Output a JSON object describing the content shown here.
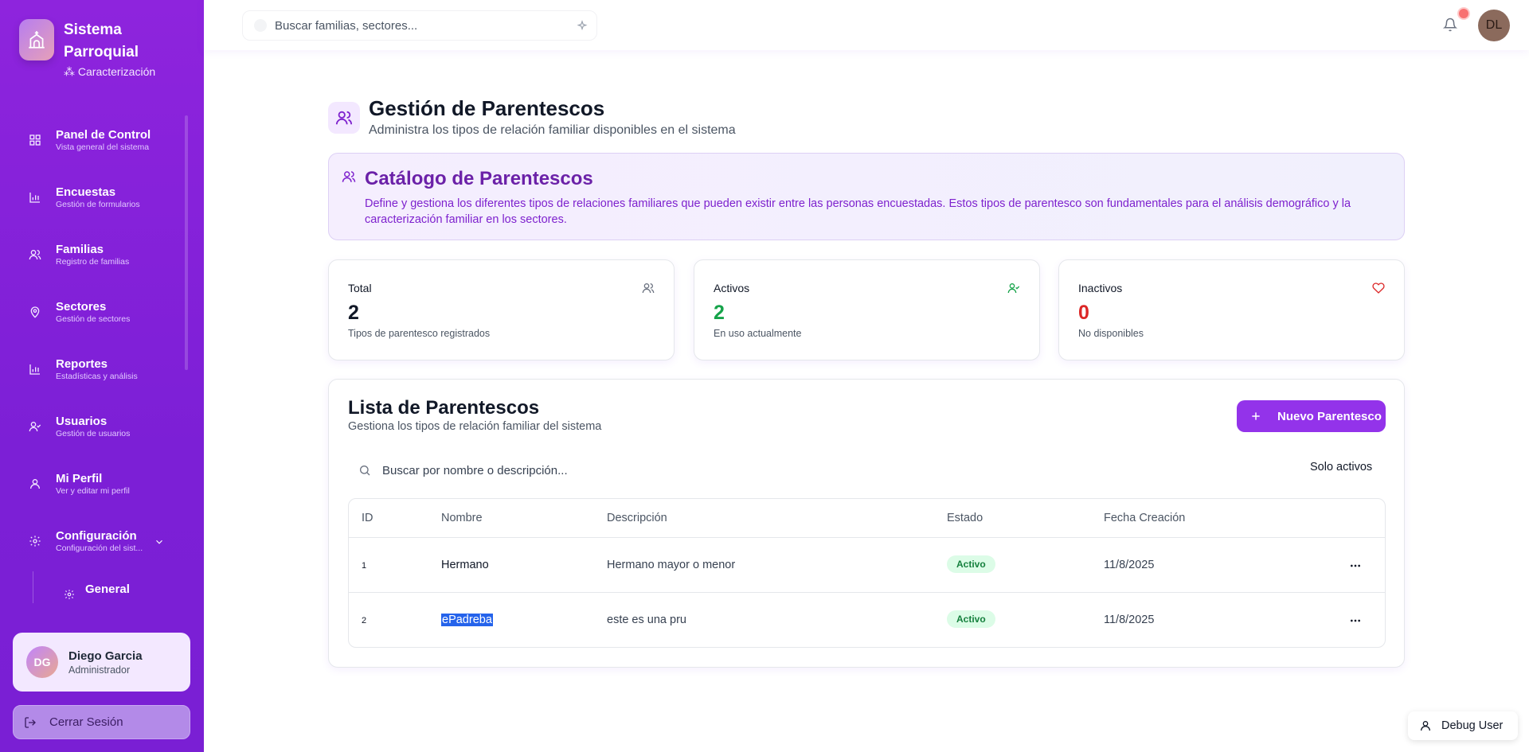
{
  "brand": {
    "title": "Sistema Parroquial",
    "subtitle": "Caracterización"
  },
  "sidebar": {
    "items": [
      {
        "label": "Panel de Control",
        "desc": "Vista general del sistema",
        "icon": "grid-icon"
      },
      {
        "label": "Encuestas",
        "desc": "Gestión de formularios",
        "icon": "bar-chart-icon"
      },
      {
        "label": "Familias",
        "desc": "Registro de familias",
        "icon": "users-icon"
      },
      {
        "label": "Sectores",
        "desc": "Gestión de sectores",
        "icon": "map-pin-icon"
      },
      {
        "label": "Reportes",
        "desc": "Estadísticas y análisis",
        "icon": "bar-chart-icon"
      },
      {
        "label": "Usuarios",
        "desc": "Gestión de usuarios",
        "icon": "user-check-icon"
      },
      {
        "label": "Mi Perfil",
        "desc": "Ver y editar mi perfil",
        "icon": "user-icon"
      },
      {
        "label": "Configuración",
        "desc": "Configuración del sist...",
        "icon": "gear-icon"
      }
    ],
    "sub_item": {
      "label": "General"
    },
    "user": {
      "initials": "DG",
      "name": "Diego Garcia",
      "role": "Administrador"
    },
    "logout_label": "Cerrar Sesión"
  },
  "topbar": {
    "search_placeholder": "Buscar familias, sectores...",
    "avatar_initials": "DL"
  },
  "page": {
    "title": "Gestión de Parentescos",
    "subtitle": "Administra los tipos de relación familiar disponibles en el sistema"
  },
  "catalog": {
    "title": "Catálogo de Parentescos",
    "description": "Define y gestiona los diferentes tipos de relaciones familiares que pueden existir entre las personas encuestadas. Estos tipos de parentesco son fundamentales para el análisis demográfico y la caracterización familiar en los sectores."
  },
  "stats": [
    {
      "label": "Total",
      "value": "2",
      "desc": "Tipos de parentesco registrados",
      "color": "#111827"
    },
    {
      "label": "Activos",
      "value": "2",
      "desc": "En uso actualmente",
      "color": "#16a34a"
    },
    {
      "label": "Inactivos",
      "value": "0",
      "desc": "No disponibles",
      "color": "#dc2626"
    }
  ],
  "list": {
    "title": "Lista de Parentescos",
    "subtitle": "Gestiona los tipos de relación familiar del sistema",
    "new_button": "Nuevo Parentesco",
    "search_placeholder": "Buscar por nombre o descripción...",
    "filter_label": "Solo activos",
    "columns": [
      "ID",
      "Nombre",
      "Descripción",
      "Estado",
      "Fecha Creación"
    ],
    "rows": [
      {
        "id": "1",
        "name": "Hermano",
        "description": "Hermano mayor o menor",
        "status": "Activo",
        "date": "11/8/2025"
      },
      {
        "id": "2",
        "name": "ePadreba",
        "description": "este es una pru",
        "status": "Activo",
        "date": "11/8/2025"
      }
    ]
  },
  "debug": {
    "label": "Debug User"
  },
  "colors": {
    "sidebar": "#8e24dd",
    "accent": "#9333ea",
    "active_badge": "#dcfce7",
    "inactive": "#dc2626"
  }
}
